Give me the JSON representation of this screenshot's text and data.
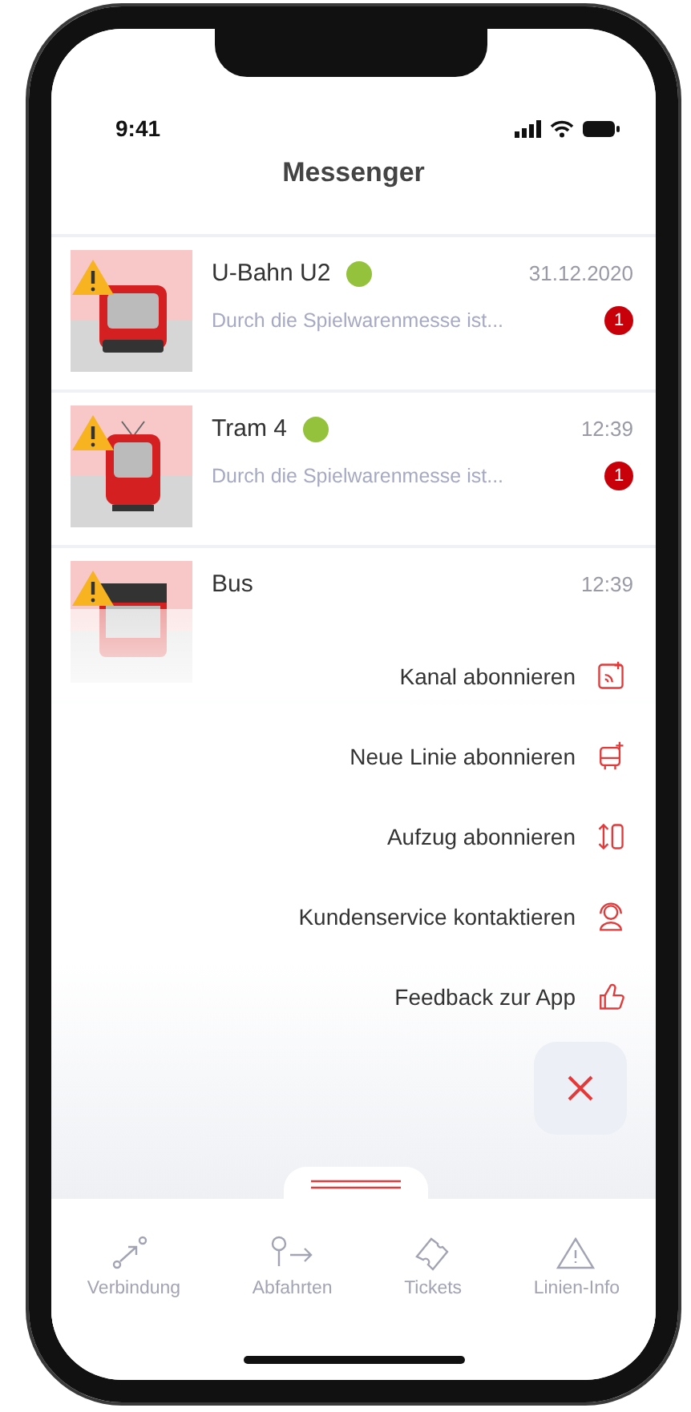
{
  "status_bar": {
    "time": "9:41"
  },
  "header": {
    "title": "Messenger"
  },
  "channels": [
    {
      "kind": "subway",
      "name": "U-Bahn U2",
      "online": true,
      "time": "31.12.2020",
      "preview": "Durch die Spielwarenmesse ist...",
      "unread": "1"
    },
    {
      "kind": "tram",
      "name": "Tram 4",
      "online": true,
      "time": "12:39",
      "preview": "Durch die Spielwarenmesse ist...",
      "unread": "1"
    },
    {
      "kind": "bus",
      "name": "Bus",
      "online": false,
      "time": "12:39"
    }
  ],
  "menu": {
    "items": [
      {
        "kind": "channel",
        "label": "Kanal abonnieren"
      },
      {
        "kind": "line",
        "label": "Neue Linie abonnieren"
      },
      {
        "kind": "elevator",
        "label": "Aufzug abonnieren"
      },
      {
        "kind": "service",
        "label": "Kundenservice kontaktieren"
      },
      {
        "kind": "feedback",
        "label": "Feedback zur App"
      }
    ]
  },
  "tabs": [
    {
      "kind": "route",
      "label": "Verbindung",
      "selected": false
    },
    {
      "kind": "departures",
      "label": "Abfahrten",
      "selected": false
    },
    {
      "kind": "tickets",
      "label": "Tickets",
      "selected": false
    },
    {
      "kind": "info",
      "label": "Linien-Info",
      "selected": false
    }
  ]
}
